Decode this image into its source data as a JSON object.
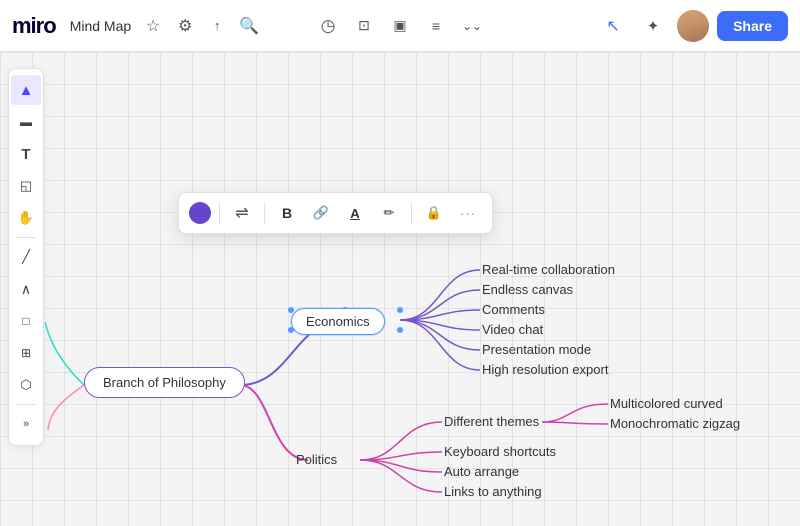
{
  "app": {
    "logo": "miro",
    "doc_title": "Mind Map",
    "star_icon": "☆",
    "settings_icon": "⚙",
    "share_icon": "↑",
    "search_icon": "🔍"
  },
  "top_center_icons": [
    "◷",
    "□⊕",
    "□□",
    "≡",
    "⌄⌄"
  ],
  "top_right": {
    "pointer_icon": "↖",
    "cursor_icon": "✦",
    "share_label": "Share"
  },
  "toolbar": {
    "bold_label": "B",
    "link_icon": "🔗",
    "underline_label": "A",
    "pen_label": "✏",
    "lock_icon": "🔒",
    "more_icon": "···"
  },
  "mindmap": {
    "root": "Branch of Philosophy",
    "economics_node": "Economics",
    "economics_children": [
      "Real-time collaboration",
      "Endless canvas",
      "Comments",
      "Video chat",
      "Presentation mode",
      "High resolution export"
    ],
    "politics_node": "Politics",
    "politics_children": [
      "Different themes",
      "Keyboard shortcuts",
      "Auto arrange",
      "Links to anything"
    ],
    "different_themes_children": [
      "Multicolored curved",
      "Monochromatic zigzag"
    ]
  },
  "sidebar_tools": [
    "▲",
    "▬",
    "T",
    "◱",
    "✋",
    "╱",
    "∧",
    "□",
    "⊞",
    "⬡",
    "»"
  ]
}
